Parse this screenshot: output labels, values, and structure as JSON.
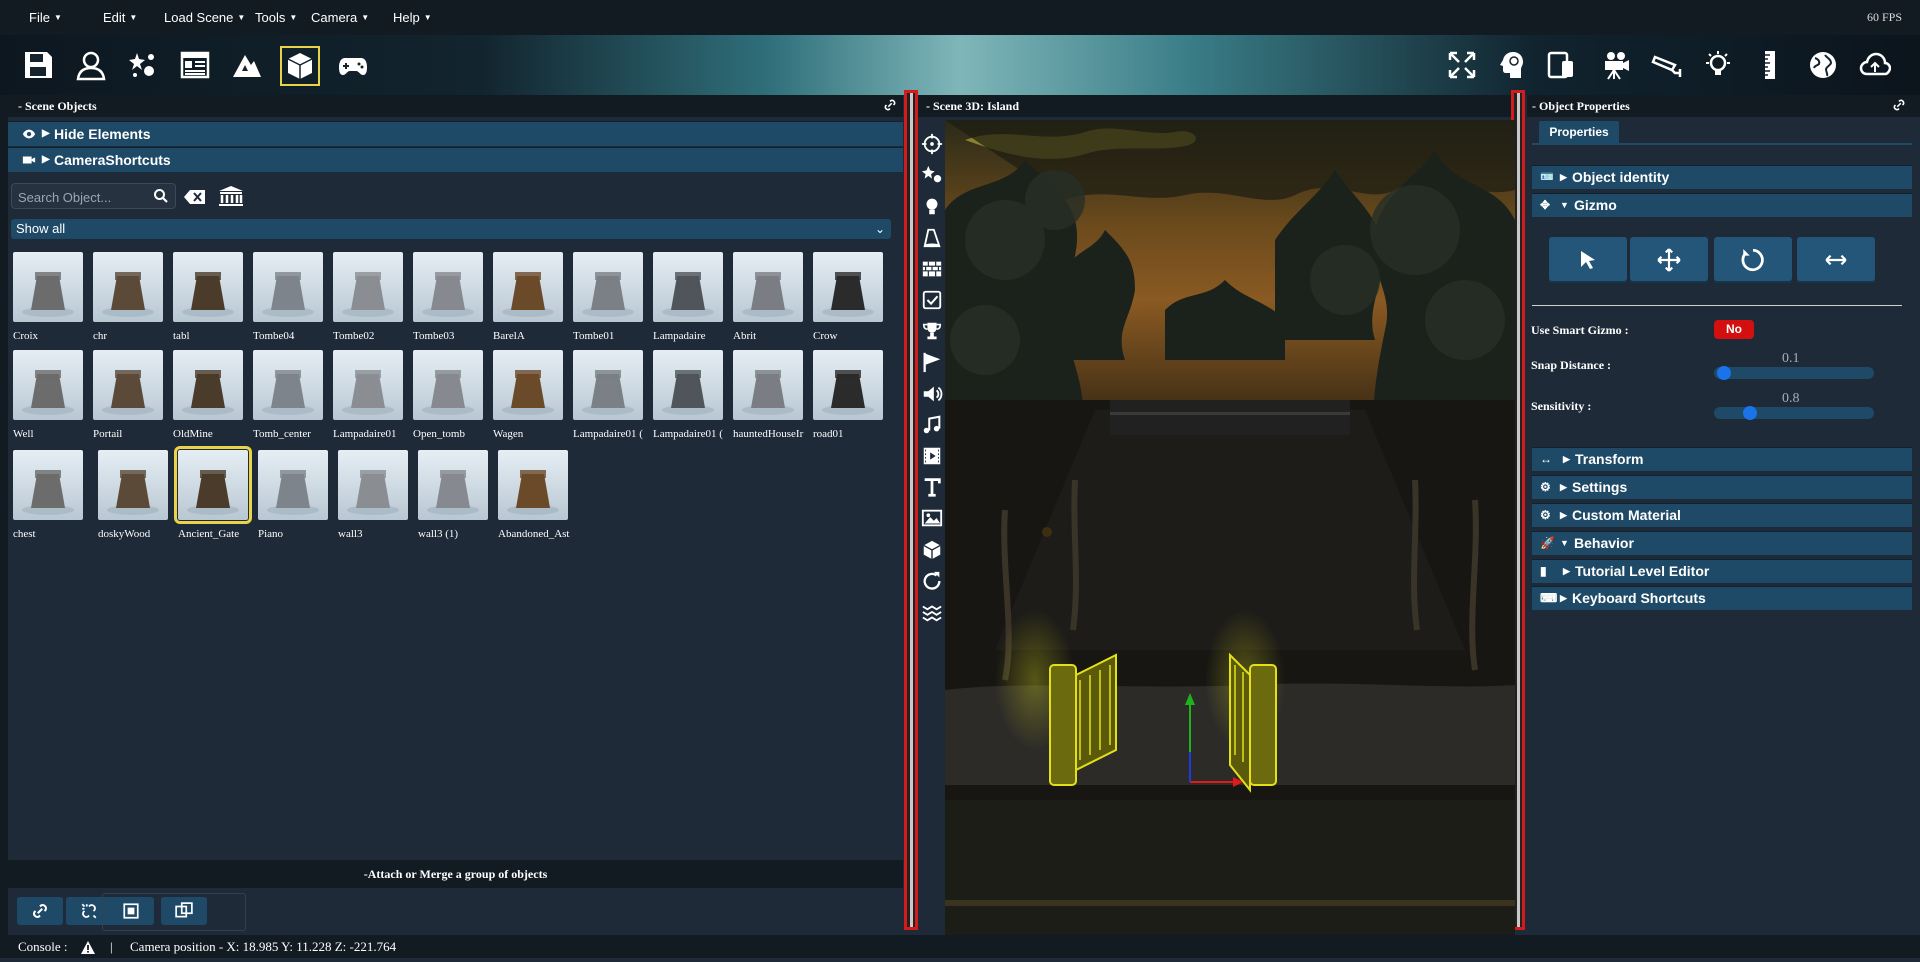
{
  "menu": {
    "items": [
      {
        "label": "File",
        "has_caret": true
      },
      {
        "label": "Edit",
        "has_caret": true
      },
      {
        "label": "Load Scene",
        "has_caret": true
      },
      {
        "label": "Tools",
        "has_caret": true
      },
      {
        "label": "Camera",
        "has_caret": true
      },
      {
        "label": "Help",
        "has_caret": true
      }
    ],
    "fps": "60 FPS"
  },
  "toolbar": {
    "left_icons": [
      "save-icon",
      "user-icon",
      "particles-icon",
      "layout-icon",
      "terrain-icon",
      "cube-icon",
      "gamepad-icon"
    ],
    "selected": "cube-icon",
    "right_icons": [
      "fullscreen-icon",
      "brain-icon",
      "mobile-device-icon",
      "movie-camera-icon",
      "security-camera-icon",
      "light-bulb-icon",
      "ruler-icon",
      "globe-icon",
      "cloud-upload-icon"
    ]
  },
  "scene_objects": {
    "title": "- Scene Objects",
    "hide_elements": "Hide Elements",
    "camera_shortcuts": "CameraShortcuts",
    "search_placeholder": "Search Object...",
    "filter": "Show all",
    "items": [
      {
        "label": "Croix"
      },
      {
        "label": "chr"
      },
      {
        "label": "tabl"
      },
      {
        "label": "Tombe04"
      },
      {
        "label": "Tombe02"
      },
      {
        "label": "Tombe03"
      },
      {
        "label": "BarelA"
      },
      {
        "label": "Tombe01"
      },
      {
        "label": "Lampadaire"
      },
      {
        "label": "Abrit"
      },
      {
        "label": "Crow"
      },
      {
        "label": "Well"
      },
      {
        "label": "Portail"
      },
      {
        "label": "OldMine"
      },
      {
        "label": "Tomb_center"
      },
      {
        "label": "Lampadaire01"
      },
      {
        "label": "Open_tomb"
      },
      {
        "label": "Wagen"
      },
      {
        "label": "Lampadaire01 ("
      },
      {
        "label": "Lampadaire01 ("
      },
      {
        "label": "hauntedHouseIr"
      },
      {
        "label": "road01"
      },
      {
        "label": "chest"
      },
      {
        "label": "doskyWood"
      },
      {
        "label": "Ancient_Gate"
      },
      {
        "label": "Piano"
      },
      {
        "label": "wall3"
      },
      {
        "label": "wall3 (1)"
      },
      {
        "label": "Abandoned_Ast"
      }
    ],
    "selected_item": "Ancient_Gate",
    "attach_label": "-Attach or Merge a group of objects"
  },
  "scene3d": {
    "title": "- Scene 3D: Island",
    "tools": [
      "target-icon",
      "particles-icon",
      "light-icon",
      "cone-icon",
      "wall-icon",
      "checkbox-icon",
      "trophy-icon",
      "flag-icon",
      "speaker-icon",
      "music-icon",
      "video-icon",
      "text-icon",
      "image-icon",
      "package-icon",
      "refresh-icon",
      "texture-icon"
    ]
  },
  "object_properties": {
    "title": "- Object Properties",
    "tab": "Properties",
    "sections": {
      "identity": "Object identity",
      "gizmo": "Gizmo",
      "transform": "Transform",
      "settings": "Settings",
      "custom_material": "Custom Material",
      "behavior": "Behavior",
      "tutorial": "Tutorial Level Editor",
      "keyboard": "Keyboard Shortcuts"
    },
    "smart_gizmo_label": "Use Smart Gizmo :",
    "smart_gizmo_value": "No",
    "snap_label": "Snap Distance :",
    "snap_value": "0.1",
    "snap_fraction": 0.02,
    "sensitivity_label": "Sensitivity :",
    "sensitivity_value": "0.8",
    "sensitivity_fraction": 0.2
  },
  "status": {
    "console": "Console :",
    "separator": "|",
    "camera_position": "Camera position - X: 18.985 Y: 11.228 Z: -221.764"
  },
  "colors": {
    "accent_panel": "#1e4a68",
    "selection": "#e8d34a",
    "splitter_border": "#d41b1b",
    "toggle_off": "#d40f0f",
    "gate_glow": "#e3e01a"
  }
}
